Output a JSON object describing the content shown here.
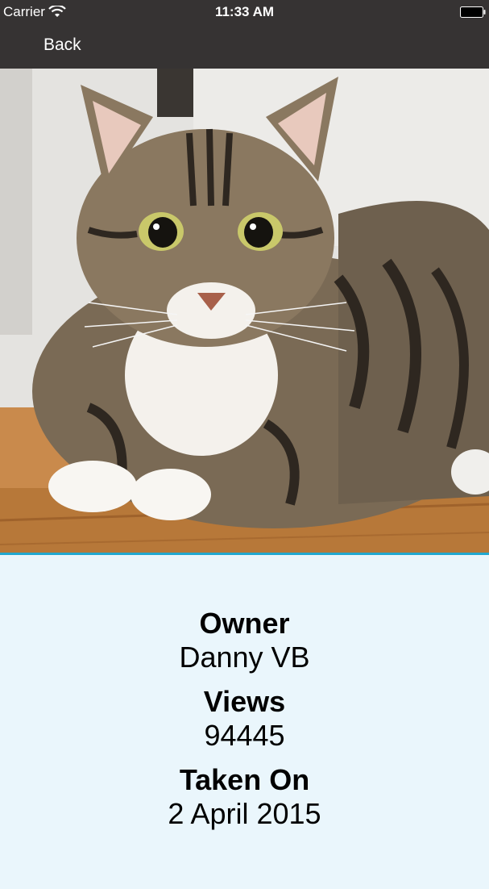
{
  "status_bar": {
    "carrier": "Carrier",
    "time": "11:33 AM",
    "wifi_icon": "wifi-icon",
    "battery_icon": "battery-icon"
  },
  "nav": {
    "back_label": "Back"
  },
  "photo": {
    "subject": "tabby-cat-photo"
  },
  "details": {
    "owner_label": "Owner",
    "owner_value": "Danny VB",
    "views_label": "Views",
    "views_value": "94445",
    "taken_label": "Taken On",
    "taken_value": "2 April 2015"
  },
  "colors": {
    "bar_background": "#363333",
    "accent_divider": "#20a8d0",
    "details_background": "#eaf6fc"
  }
}
